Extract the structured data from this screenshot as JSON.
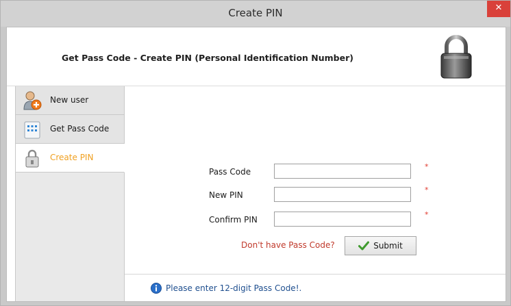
{
  "window": {
    "title": "Create PIN",
    "close_glyph": "✕"
  },
  "header": {
    "title": "Get Pass Code - Create PIN (Personal Identification Number)",
    "icon": "padlock-icon"
  },
  "sidebar": {
    "items": [
      {
        "label": "New user",
        "icon": "new-user-icon",
        "active": false
      },
      {
        "label": "Get Pass Code",
        "icon": "keypad-icon",
        "active": false
      },
      {
        "label": "Create PIN",
        "icon": "lock-icon",
        "active": true
      }
    ]
  },
  "form": {
    "fields": [
      {
        "label": "Pass Code",
        "value": "",
        "required_mark": "*"
      },
      {
        "label": "New PIN",
        "value": "",
        "required_mark": "*"
      },
      {
        "label": "Confirm PIN",
        "value": "",
        "required_mark": "*"
      }
    ],
    "no_pass_code_link": "Don't have Pass Code?",
    "submit_label": "Submit"
  },
  "status": {
    "message": "Please enter 12-digit Pass Code!.",
    "icon": "info-icon"
  },
  "colors": {
    "active_nav_text": "#f0a020",
    "required_mark": "#e13b2f",
    "link": "#c0392b",
    "status_text": "#1f4f8f",
    "close_button": "#d9413a"
  }
}
